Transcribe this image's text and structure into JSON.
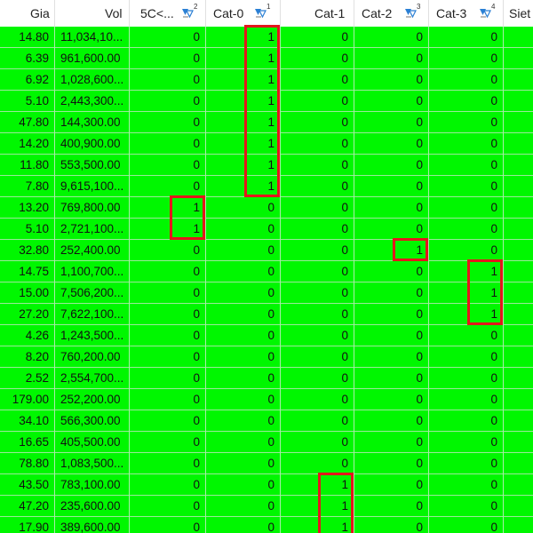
{
  "columns": [
    {
      "label": "Gia",
      "sort_icon": false,
      "sort_rank": ""
    },
    {
      "label": "Vol",
      "sort_icon": false,
      "sort_rank": ""
    },
    {
      "label": "5C<...",
      "sort_icon": true,
      "sort_rank": "2"
    },
    {
      "label": "Cat-0",
      "sort_icon": true,
      "sort_rank": "1"
    },
    {
      "label": "Cat-1",
      "sort_icon": false,
      "sort_rank": ""
    },
    {
      "label": "Cat-2",
      "sort_icon": true,
      "sort_rank": "3"
    },
    {
      "label": "Cat-3",
      "sort_icon": true,
      "sort_rank": "4"
    },
    {
      "label": "Siet",
      "sort_icon": false,
      "sort_rank": ""
    }
  ],
  "rows": [
    [
      "14.80",
      "11,034,10...",
      "0",
      "1",
      "0",
      "0",
      "0",
      ""
    ],
    [
      "6.39",
      "961,600.00",
      "0",
      "1",
      "0",
      "0",
      "0",
      ""
    ],
    [
      "6.92",
      "1,028,600...",
      "0",
      "1",
      "0",
      "0",
      "0",
      ""
    ],
    [
      "5.10",
      "2,443,300...",
      "0",
      "1",
      "0",
      "0",
      "0",
      ""
    ],
    [
      "47.80",
      "144,300.00",
      "0",
      "1",
      "0",
      "0",
      "0",
      ""
    ],
    [
      "14.20",
      "400,900.00",
      "0",
      "1",
      "0",
      "0",
      "0",
      ""
    ],
    [
      "11.80",
      "553,500.00",
      "0",
      "1",
      "0",
      "0",
      "0",
      ""
    ],
    [
      "7.80",
      "9,615,100...",
      "0",
      "1",
      "0",
      "0",
      "0",
      ""
    ],
    [
      "13.20",
      "769,800.00",
      "1",
      "0",
      "0",
      "0",
      "0",
      ""
    ],
    [
      "5.10",
      "2,721,100...",
      "1",
      "0",
      "0",
      "0",
      "0",
      ""
    ],
    [
      "32.80",
      "252,400.00",
      "0",
      "0",
      "0",
      "1",
      "0",
      ""
    ],
    [
      "14.75",
      "1,100,700...",
      "0",
      "0",
      "0",
      "0",
      "1",
      ""
    ],
    [
      "15.00",
      "7,506,200...",
      "0",
      "0",
      "0",
      "0",
      "1",
      ""
    ],
    [
      "27.20",
      "7,622,100...",
      "0",
      "0",
      "0",
      "0",
      "1",
      ""
    ],
    [
      "4.26",
      "1,243,500...",
      "0",
      "0",
      "0",
      "0",
      "0",
      ""
    ],
    [
      "8.20",
      "760,200.00",
      "0",
      "0",
      "0",
      "0",
      "0",
      ""
    ],
    [
      "2.52",
      "2,554,700...",
      "0",
      "0",
      "0",
      "0",
      "0",
      ""
    ],
    [
      "179.00",
      "252,200.00",
      "0",
      "0",
      "0",
      "0",
      "0",
      ""
    ],
    [
      "34.10",
      "566,300.00",
      "0",
      "0",
      "0",
      "0",
      "0",
      ""
    ],
    [
      "16.65",
      "405,500.00",
      "0",
      "0",
      "0",
      "0",
      "0",
      ""
    ],
    [
      "78.80",
      "1,083,500...",
      "0",
      "0",
      "0",
      "0",
      "0",
      ""
    ],
    [
      "43.50",
      "783,100.00",
      "0",
      "0",
      "1",
      "0",
      "0",
      ""
    ],
    [
      "47.20",
      "235,600.00",
      "0",
      "0",
      "1",
      "0",
      "0",
      ""
    ],
    [
      "17.90",
      "389,600.00",
      "0",
      "0",
      "1",
      "0",
      "0",
      ""
    ]
  ],
  "colors": {
    "row_background": "#00f700",
    "highlight_border": "#e4161c",
    "header_background": "#ffffff",
    "sort_icon_color": "#2a7fd4"
  },
  "highlights": [
    {
      "column": "Cat-0",
      "from_row": 0,
      "to_row": 7
    },
    {
      "column": "5C<...",
      "from_row": 8,
      "to_row": 9
    },
    {
      "column": "Cat-2",
      "from_row": 10,
      "to_row": 10
    },
    {
      "column": "Cat-3",
      "from_row": 11,
      "to_row": 13
    },
    {
      "column": "Cat-1",
      "from_row": 21,
      "to_row": 23
    }
  ]
}
